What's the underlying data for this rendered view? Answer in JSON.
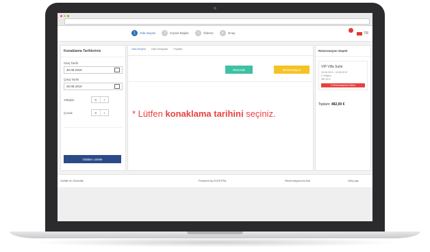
{
  "nav": {
    "steps": [
      {
        "num": "1",
        "label": "Oda Seçimi"
      },
      {
        "num": "2",
        "label": "Kişisel Bilgiler"
      },
      {
        "num": "3",
        "label": "Ödeme"
      },
      {
        "num": "4",
        "label": "Onay"
      }
    ],
    "language": "TR"
  },
  "left_panel": {
    "title": "Konaklama Tarihleriniz",
    "checkin_label": "Giriş Tarihi",
    "checkin_value": "30.08.2019",
    "checkout_label": "Çıkış Tarihi",
    "checkout_value": "30.08.2019",
    "adults_label": "Yetişkin",
    "adults_value": "0",
    "children_label": "Çocuk",
    "children_value": "0",
    "stepper_minus": "-",
    "stepper_plus": "+",
    "find_button": "Odaları Listele"
  },
  "middle": {
    "tabs": [
      "Oda Seçimi",
      "Oda Detayları",
      "Fiyatlar"
    ],
    "green_button": "Rezervik",
    "yellow_button": "Rezervasyon",
    "message_prefix": "* Lütfen ",
    "message_bold": "konaklama tarihini",
    "message_suffix": " seçiniz."
  },
  "right_panel": {
    "title": "Rezervasyon Sepeti",
    "item_name": "VIP Villa Suite",
    "item_dates": "30.08.2019 - 30.08.2019",
    "item_guests": "0 Yetişkin",
    "item_price": "482,00 €",
    "remove_button": "X Rezervasyonu Kaldır",
    "total_label": "Toplam:",
    "total_value": "482,00 €"
  },
  "footer": {
    "left": "Gizlilik ve Güvenlik",
    "center": "Powered by ELEKTRA",
    "right_mid": "Rezervasyonunu Bul",
    "right": "Giriş yap"
  },
  "colors": {
    "accent_blue": "#2f6fb3",
    "green": "#3fc1a3",
    "yellow": "#f4c326",
    "red": "#e8413f",
    "navy": "#2b4a88"
  }
}
